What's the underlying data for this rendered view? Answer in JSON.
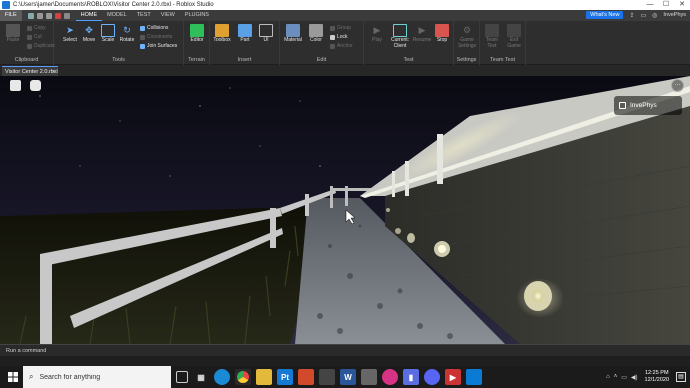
{
  "window": {
    "title": "C:\\Users\\jamer\\Documents\\ROBLOX\\Visitor Center 2.0.rbxl - Roblox Studio",
    "controls": [
      "—",
      "☐",
      "✕"
    ]
  },
  "menubar": {
    "file": "FILE",
    "tabs": [
      "HOME",
      "MODEL",
      "TEST",
      "VIEW",
      "PLUGINS"
    ],
    "active_tab": "HOME",
    "whats_new": "What's New",
    "user": "InvePhys"
  },
  "ribbon": {
    "clipboard": {
      "label": "Clipboard",
      "paste": "Paste",
      "copy": "Copy",
      "cut": "Cut",
      "duplicate": "Duplicate"
    },
    "tools": {
      "label": "Tools",
      "select": "Select",
      "move": "Move",
      "scale": "Scale",
      "rotate": "Rotate",
      "collisions": "Collisions",
      "constraints": "Constraints",
      "join_surfaces": "Join Surfaces"
    },
    "terrain": {
      "label": "Terrain",
      "editor": "Editor"
    },
    "insert": {
      "label": "Insert",
      "toolbox": "Toolbox",
      "part": "Part",
      "ui": "UI"
    },
    "edit": {
      "label": "Edit",
      "material": "Material",
      "color": "Color",
      "group": "Group",
      "lock": "Lock",
      "anchor": "Anchor"
    },
    "test": {
      "label": "Test",
      "play": "Play",
      "current_client": "Current: Client",
      "resume": "Resume",
      "stop": "Stop"
    },
    "settings": {
      "label": "Settings",
      "game_settings": "Game Settings"
    },
    "team_test": {
      "label": "Team Test",
      "team_test": "Team Test",
      "exit_game": "Exit Game"
    }
  },
  "document": {
    "tab_label": "Visitor Center 2.0.rbxl",
    "close": "×"
  },
  "viewport": {
    "overlay_user": "InvePhys",
    "more": "···"
  },
  "command_bar": {
    "placeholder": "Run a command"
  },
  "taskbar": {
    "search_placeholder": "Search for anything",
    "time": "12:25 PM",
    "date": "12/1/2020"
  },
  "colors": {
    "accent": "#1a73e8",
    "stop_red": "#d9534f",
    "terrain_green": "#2fbf5a"
  }
}
